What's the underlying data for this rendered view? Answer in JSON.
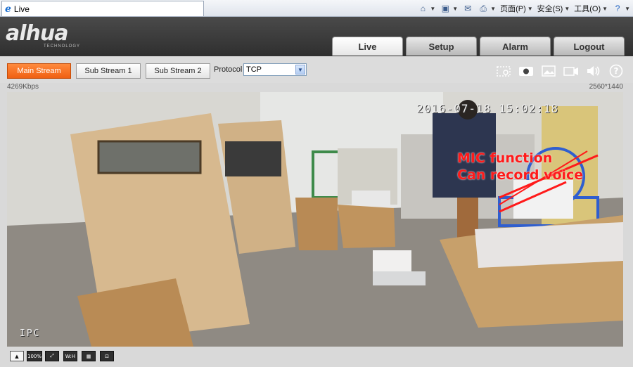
{
  "browser": {
    "tab_title": "Live",
    "tools": [
      {
        "icon": "home-icon",
        "label": ""
      },
      {
        "icon": "feeds-icon",
        "label": ""
      },
      {
        "icon": "mail-icon",
        "label": ""
      },
      {
        "icon": "print-icon",
        "label": ""
      },
      {
        "icon": "page-menu",
        "label": "页面(P)"
      },
      {
        "icon": "safety-menu",
        "label": "安全(S)"
      },
      {
        "icon": "tools-menu",
        "label": "工具(O)"
      },
      {
        "icon": "help-icon",
        "label": ""
      }
    ]
  },
  "header": {
    "logo": "alhua",
    "logo_sub": "TECHNOLOGY",
    "tabs": [
      {
        "label": "Live",
        "active": true
      },
      {
        "label": "Setup",
        "active": false
      },
      {
        "label": "Alarm",
        "active": false
      },
      {
        "label": "Logout",
        "active": false
      }
    ]
  },
  "toolbar": {
    "streams": [
      {
        "label": "Main Stream",
        "active": true
      },
      {
        "label": "Sub Stream 1",
        "active": false
      },
      {
        "label": "Sub Stream 2",
        "active": false
      }
    ],
    "protocol_label": "Protocol",
    "protocol_value": "TCP",
    "right_icons": [
      "digital-zoom-icon",
      "snapshot-icon",
      "triple-snapshot-icon",
      "record-icon",
      "audio-speaker-icon",
      "help-icon"
    ]
  },
  "stream_info": {
    "bitrate": "4269Kbps",
    "resolution": "2560*1440"
  },
  "video": {
    "timestamp": "2016-07-18 15:02:18",
    "channel": "IPC",
    "annotation_line1": "MIC function",
    "annotation_line2": "Can record voice",
    "annotation_color": "#ff1a1a"
  },
  "bottom_controls": [
    {
      "icon": "original-size-icon",
      "label": ""
    },
    {
      "icon": "scale-100-icon",
      "label": "100%"
    },
    {
      "icon": "fullscreen-icon",
      "label": ""
    },
    {
      "icon": "aspect-wh-icon",
      "label": "W:H"
    },
    {
      "icon": "fluency-icon",
      "label": ""
    },
    {
      "icon": "ptz-icon",
      "label": ""
    }
  ],
  "colors": {
    "accent": "#f06012",
    "header_bg": "#3a3a3a",
    "toolbar_bg": "#dcdcdc"
  }
}
